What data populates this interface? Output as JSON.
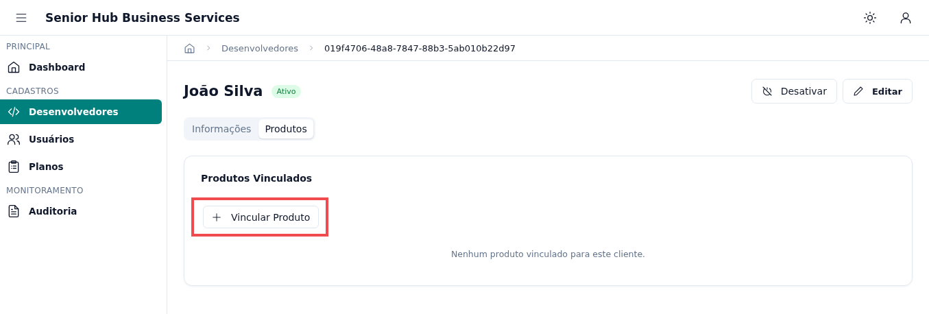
{
  "header": {
    "title": "Senior Hub Business Services"
  },
  "sidebar": {
    "sections": [
      {
        "title": "PRINCIPAL",
        "items": [
          {
            "label": "Dashboard",
            "selected": false
          }
        ]
      },
      {
        "title": "CADASTROS",
        "items": [
          {
            "label": "Desenvolvedores",
            "selected": true
          },
          {
            "label": "Usuários",
            "selected": false
          },
          {
            "label": "Planos",
            "selected": false
          }
        ]
      },
      {
        "title": "MONITORAMENTO",
        "items": [
          {
            "label": "Auditoria",
            "selected": false
          }
        ]
      }
    ]
  },
  "breadcrumb": [
    "Desenvolvedores",
    "019f4706-48a8-7847-88b3-5ab010b22d97"
  ],
  "page": {
    "title": "João Silva",
    "status": "Ativo",
    "actions": [
      {
        "label": "Desativar",
        "bold": false
      },
      {
        "label": "Editar",
        "bold": true
      }
    ]
  },
  "tabs": [
    {
      "label": "Informações",
      "selected": false
    },
    {
      "label": "Produtos",
      "selected": true
    }
  ],
  "card": {
    "title": "Produtos Vinculados",
    "button": {
      "label": "Vincular Produto",
      "highlighted": true
    },
    "empty_message": "Nenhum produto vinculado para este cliente."
  }
}
